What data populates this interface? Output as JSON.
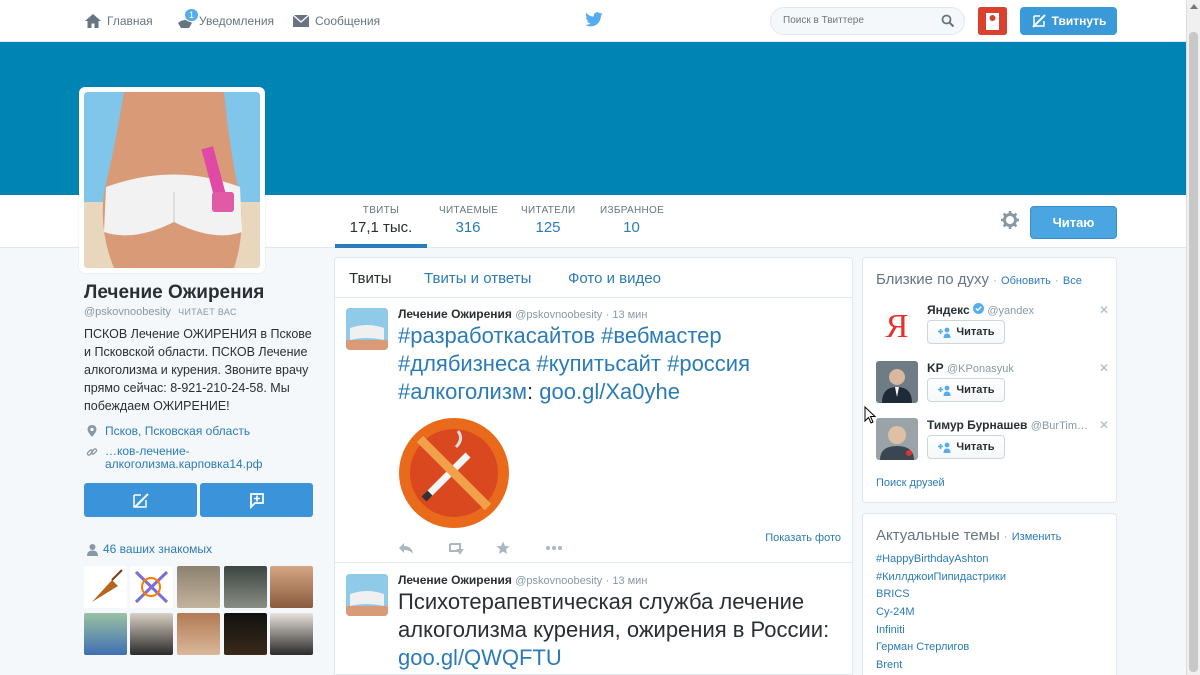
{
  "nav": {
    "home": "Главная",
    "notifications": "Уведомления",
    "notifications_count": "1",
    "messages": "Сообщения",
    "search_placeholder": "Поиск в Твиттере",
    "tweet_button": "Твитнуть"
  },
  "profile": {
    "name": "Лечение Ожирения",
    "handle": "@pskovnoobesity",
    "follows_you": "ЧИТАЕТ ВАС",
    "bio": "ПСКОВ Лечение ОЖИРЕНИЯ в Пскове и Псковской области. ПСКОВ Лечение алкоголизма и курения. Звоните врачу прямо сейчас: 8-921-210-24-58. Мы побеждаем ОЖИРЕНИЕ!",
    "location": "Псков, Псковская область",
    "url": "…ков-лечение-алкоголизма.карповка14.рф",
    "known_followers": "46 ваших знакомых"
  },
  "stats": [
    {
      "label": "ТВИТЫ",
      "value": "17,1 тыс."
    },
    {
      "label": "ЧИТАЕМЫЕ",
      "value": "316"
    },
    {
      "label": "ЧИТАТЕЛИ",
      "value": "125"
    },
    {
      "label": "ИЗБРАННОЕ",
      "value": "10"
    }
  ],
  "follow_button": "Читаю",
  "timeline": {
    "tabs": [
      "Твиты",
      "Твиты и ответы",
      "Фото и видео"
    ],
    "tweets": [
      {
        "name": "Лечение Ожирения",
        "handle": "@pskovnoobesity",
        "time": "· 13 мин",
        "hashtags": "#разработкасайтов #вебмастер #длябизнеса #купитьсайт #россия #алкоголизм",
        "colon": ":",
        "link": "goo.gl/Xa0yhe",
        "show_photo": "Показать фото"
      },
      {
        "name": "Лечение Ожирения",
        "handle": "@pskovnoobesity",
        "time": "· 13 мин",
        "text": "Психотерапевтическая служба лечение алкоголизма курения, ожирения в России:",
        "link": "goo.gl/QWQFTU"
      }
    ]
  },
  "who_to_follow": {
    "title": "Близкие по духу",
    "refresh": "Обновить",
    "all": "Все",
    "follow_label": "Читать",
    "users": [
      {
        "name": "Яндекс",
        "handle": "@yandex"
      },
      {
        "name": "KP",
        "handle": "@KPonasyuk"
      },
      {
        "name": "Тимур Бурнашев",
        "handle": "@BurTim…"
      }
    ],
    "find_friends": "Поиск друзей"
  },
  "trends": {
    "title": "Актуальные темы",
    "change": "Изменить",
    "items": [
      "#HappyBirthdayAshton",
      "#КиллджоиПипидастрики",
      "BRICS",
      "Су-24М",
      "Infiniti",
      "Герман Стерлигов",
      "Brent"
    ]
  },
  "colors": {
    "banner": "#0084b4",
    "link": "#2b7bb9",
    "button": "#3b94d9"
  }
}
